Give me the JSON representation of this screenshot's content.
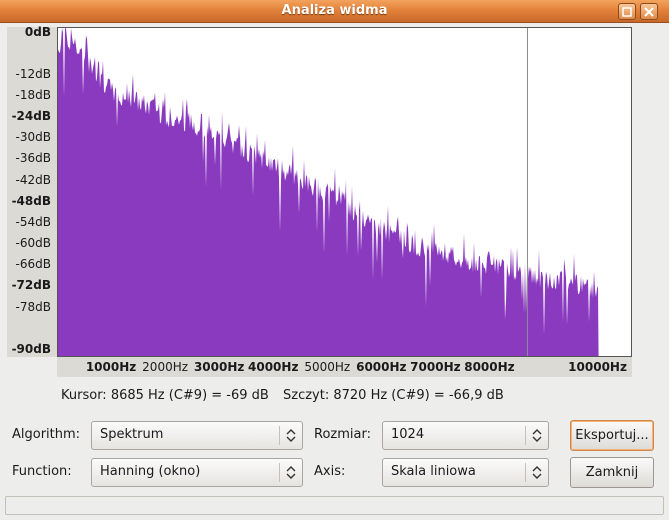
{
  "window": {
    "title": "Analiza widma"
  },
  "colors": {
    "spectrum": "#8a3abf",
    "cursor_line": "#8c8c8c"
  },
  "chart_data": {
    "type": "area",
    "ylabels": [
      {
        "text": "0dB",
        "db": 0,
        "major": true
      },
      {
        "text": "-12dB",
        "db": -12,
        "major": false
      },
      {
        "text": "-18dB",
        "db": -18,
        "major": false
      },
      {
        "text": "-24dB",
        "db": -24,
        "major": true
      },
      {
        "text": "-30dB",
        "db": -30,
        "major": false
      },
      {
        "text": "-36dB",
        "db": -36,
        "major": false
      },
      {
        "text": "-42dB",
        "db": -42,
        "major": false
      },
      {
        "text": "-48dB",
        "db": -48,
        "major": true
      },
      {
        "text": "-54dB",
        "db": -54,
        "major": false
      },
      {
        "text": "-60dB",
        "db": -60,
        "major": false
      },
      {
        "text": "-66dB",
        "db": -66,
        "major": false
      },
      {
        "text": "-72dB",
        "db": -72,
        "major": true
      },
      {
        "text": "-78dB",
        "db": -78,
        "major": false
      },
      {
        "text": "-90dB",
        "db": -90,
        "major": true
      }
    ],
    "xlabels": [
      {
        "text": "1000Hz",
        "hz": 1000,
        "major": true
      },
      {
        "text": "2000Hz",
        "hz": 2000,
        "major": false
      },
      {
        "text": "3000Hz",
        "hz": 3000,
        "major": true
      },
      {
        "text": "4000Hz",
        "hz": 4000,
        "major": true
      },
      {
        "text": "5000Hz",
        "hz": 5000,
        "major": false
      },
      {
        "text": "6000Hz",
        "hz": 6000,
        "major": true
      },
      {
        "text": "7000Hz",
        "hz": 7000,
        "major": true
      },
      {
        "text": "8000Hz",
        "hz": 8000,
        "major": true
      },
      {
        "text": "10000Hz",
        "hz": 10000,
        "major": true
      }
    ],
    "xlim": [
      0,
      10600
    ],
    "ylim": [
      -92,
      1
    ],
    "cursor_hz": 8685,
    "spectrum_end_hz": 10000,
    "envelope": [
      {
        "hz": 0,
        "db": -5
      },
      {
        "hz": 100,
        "db": -1
      },
      {
        "hz": 500,
        "db": -8
      },
      {
        "hz": 1000,
        "db": -17
      },
      {
        "hz": 1500,
        "db": -20
      },
      {
        "hz": 2000,
        "db": -24
      },
      {
        "hz": 2500,
        "db": -26
      },
      {
        "hz": 3000,
        "db": -30
      },
      {
        "hz": 3500,
        "db": -34
      },
      {
        "hz": 4000,
        "db": -38
      },
      {
        "hz": 4500,
        "db": -42
      },
      {
        "hz": 5000,
        "db": -46
      },
      {
        "hz": 5500,
        "db": -52
      },
      {
        "hz": 6000,
        "db": -56
      },
      {
        "hz": 6500,
        "db": -60
      },
      {
        "hz": 7000,
        "db": -62
      },
      {
        "hz": 7500,
        "db": -65
      },
      {
        "hz": 8000,
        "db": -66
      },
      {
        "hz": 8500,
        "db": -68
      },
      {
        "hz": 9000,
        "db": -70
      },
      {
        "hz": 9500,
        "db": -71
      },
      {
        "hz": 10000,
        "db": -73
      }
    ]
  },
  "readout": {
    "cursor": "Kursor: 8685 Hz (C#9) = -69 dB",
    "peak": "Szczyt: 8720 Hz (C#9) = -66,9 dB"
  },
  "controls": {
    "algorithm_label": "Algorithm:",
    "algorithm_value": "Spektrum",
    "size_label": "Rozmiar:",
    "size_value": "1024",
    "function_label": "Function:",
    "function_value": "Hanning (okno)",
    "axis_label": "Axis:",
    "axis_value": "Skala liniowa",
    "export_button": "Eksportuj...",
    "close_button": "Zamknij"
  }
}
